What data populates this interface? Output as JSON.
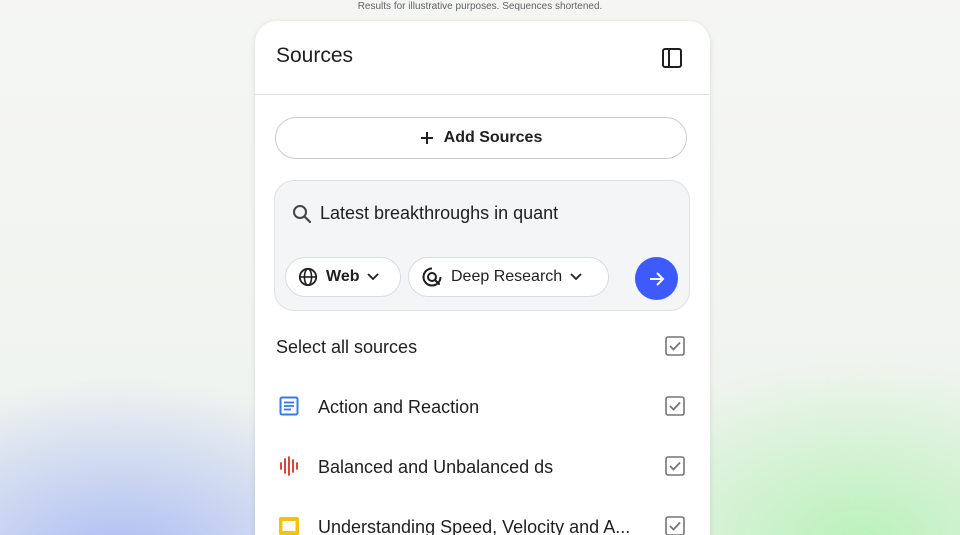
{
  "disclaimer": "Results for illustrative purposes. Sequences shortened.",
  "panel": {
    "title": "Sources",
    "toggle_icon": "sidebar-toggle-icon"
  },
  "add_sources": {
    "label": "Add Sources",
    "icon": "plus-icon"
  },
  "search": {
    "value": "Latest breakthroughs in quant",
    "icon": "search-icon",
    "chips": [
      {
        "label": "Web",
        "icon": "globe-icon",
        "dropdown_icon": "chevron-down-icon"
      },
      {
        "label": "Deep Research",
        "icon": "deep-research-icon",
        "dropdown_icon": "chevron-down-icon"
      }
    ],
    "submit_icon": "arrow-right-icon",
    "submit_color": "#3d5afe"
  },
  "select_all": {
    "label": "Select all sources",
    "checked": true
  },
  "sources": [
    {
      "label": "Action and Reaction",
      "icon": "document-icon",
      "icon_color": "#3b78e7",
      "checked": true
    },
    {
      "label": "Balanced and Unbalanced ds",
      "icon": "audio-waveform-icon",
      "icon_color": "#d93025",
      "checked": true
    },
    {
      "label": "Understanding Speed, Velocity and A...",
      "icon": "slides-icon",
      "icon_color": "#f4c20d",
      "checked": true
    }
  ]
}
